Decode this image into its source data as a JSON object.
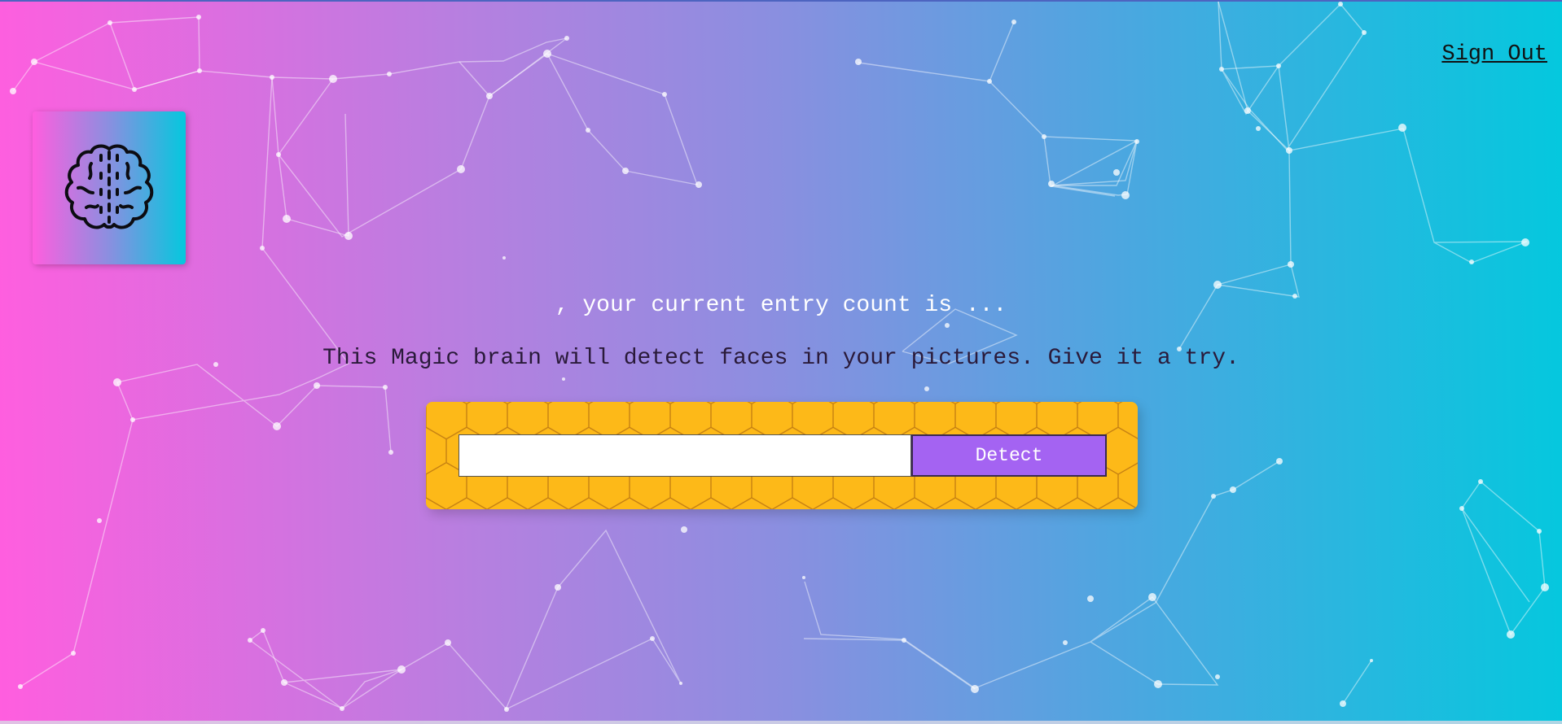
{
  "header": {
    "sign_out_label": "Sign Out"
  },
  "logo": {
    "icon": "brain-icon"
  },
  "rank": {
    "text": ", your current entry count is ..."
  },
  "intro": {
    "text": "This Magic brain will detect faces in your pictures. Give it a try."
  },
  "image_form": {
    "url_value": "",
    "detect_label": "Detect"
  },
  "colors": {
    "gradient_start": "#ff5edf",
    "gradient_end": "#04c8de",
    "panel": "#fdb918",
    "button": "#a463f2"
  }
}
